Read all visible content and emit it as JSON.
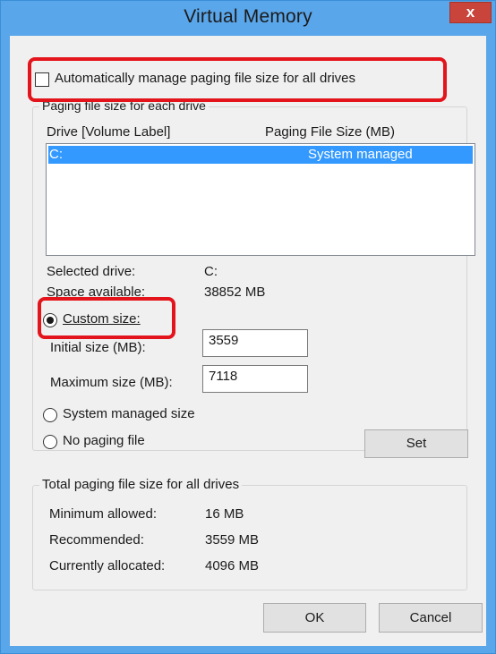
{
  "window": {
    "title": "Virtual Memory",
    "close_label": "x"
  },
  "auto_manage": {
    "label": "Automatically manage paging file size for all drives",
    "checked": false
  },
  "paging_group": {
    "legend": "Paging file size for each drive",
    "col_drive": "Drive  [Volume Label]",
    "col_size": "Paging File Size (MB)",
    "rows": [
      {
        "drive": "C:",
        "size": "System managed",
        "selected": true
      }
    ]
  },
  "selected_drive": {
    "label": "Selected drive:",
    "value": "C:"
  },
  "space_available": {
    "label": "Space available:",
    "value": "38852 MB"
  },
  "options": {
    "custom_size_label": "Custom size:",
    "initial_size_label": "Initial size (MB):",
    "initial_size_value": "3559",
    "maximum_size_label": "Maximum size (MB):",
    "maximum_size_value": "7118",
    "system_managed_label": "System managed size",
    "no_paging_label": "No paging file",
    "selected": "custom"
  },
  "set_button": "Set",
  "total_group": {
    "legend": "Total paging file size for all drives",
    "minimum_label": "Minimum allowed:",
    "minimum_value": "16 MB",
    "recommended_label": "Recommended:",
    "recommended_value": "3559 MB",
    "allocated_label": "Currently allocated:",
    "allocated_value": "4096 MB"
  },
  "footer": {
    "ok_label": "OK",
    "cancel_label": "Cancel"
  },
  "colors": {
    "title_bar": "#5aa6ea",
    "close_button": "#c9443a",
    "selection": "#3399ff",
    "highlight_annotation": "#e3141b"
  }
}
